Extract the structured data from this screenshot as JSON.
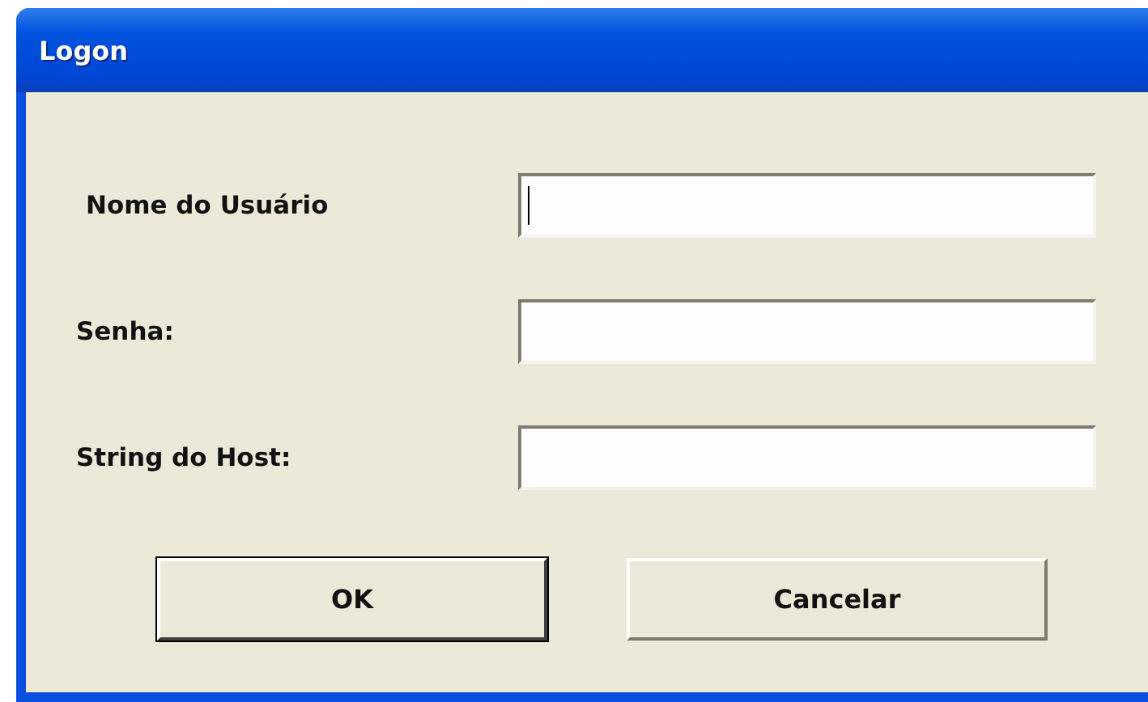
{
  "window": {
    "title": "Logon"
  },
  "fields": [
    {
      "label": "Nome do Usuário",
      "focused": true
    },
    {
      "label": "Senha:",
      "focused": false
    },
    {
      "label": "String do Host:",
      "focused": false
    }
  ],
  "buttons": [
    {
      "label": "OK",
      "default": true
    },
    {
      "label": "Cancelar",
      "default": false
    }
  ]
}
